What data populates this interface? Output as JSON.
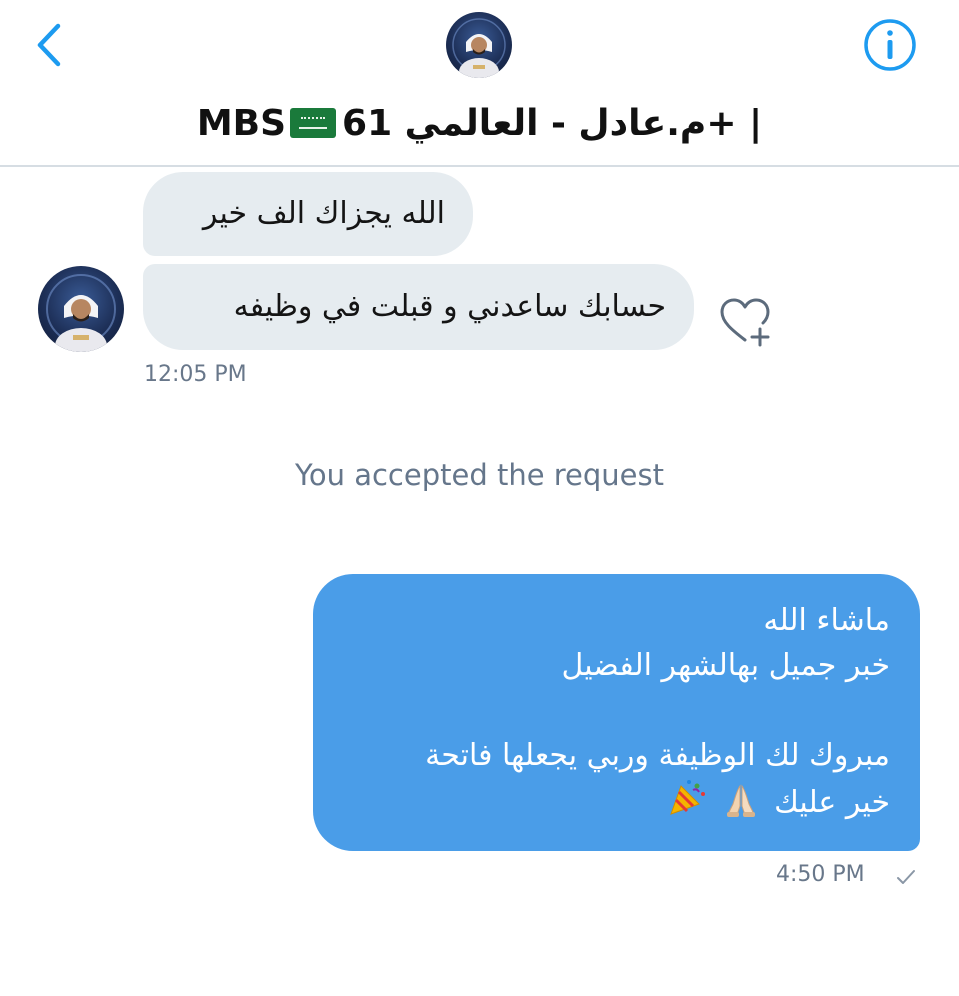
{
  "header": {
    "title_text": "م.عادل - العالمي 61+ |",
    "title_suffix": "MBS",
    "back_icon": "chevron-left-icon",
    "info_icon": "info-circle-icon",
    "accent_color": "#1d9bf0"
  },
  "messages": {
    "incoming": [
      {
        "text": "الله يجزاك الف خير"
      },
      {
        "text": "حسابك ساعدني و قبلت في وظيفه"
      }
    ],
    "incoming_time": "12:05 PM",
    "system": "You accepted the request",
    "outgoing": {
      "lines": [
        "ماشاء الله",
        "خبر جميل بهالشهر الفضيل",
        "مبروك لك الوظيفة وربي يجعلها فاتحة",
        "خير عليك"
      ],
      "emojis": [
        "folded-hands-icon",
        "party-popper-icon"
      ]
    },
    "outgoing_time": "4:50 PM"
  },
  "colors": {
    "incoming_bubble": "#e6ecf0",
    "outgoing_bubble": "#4a9de8",
    "meta_text": "#68778a"
  }
}
